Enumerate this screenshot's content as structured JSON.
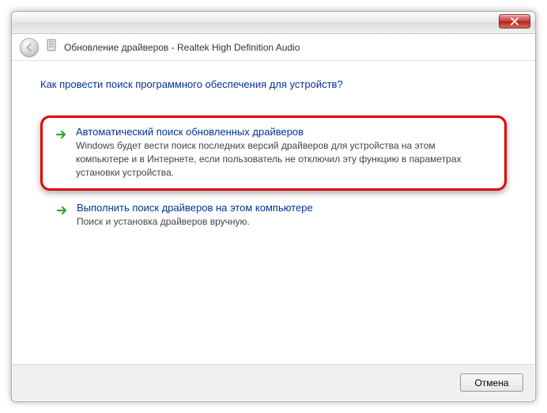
{
  "window": {
    "title": "Обновление драйверов - Realtek High Definition Audio"
  },
  "heading": "Как провести поиск программного обеспечения для устройств?",
  "options": [
    {
      "title": "Автоматический поиск обновленных драйверов",
      "description": "Windows будет вести поиск последних версий драйверов для устройства на этом компьютере и в Интернете, если пользователь не отключил эту функцию в параметрах установки устройства."
    },
    {
      "title": "Выполнить поиск драйверов на этом компьютере",
      "description": "Поиск и установка драйверов вручную."
    }
  ],
  "buttons": {
    "cancel": "Отмена"
  }
}
